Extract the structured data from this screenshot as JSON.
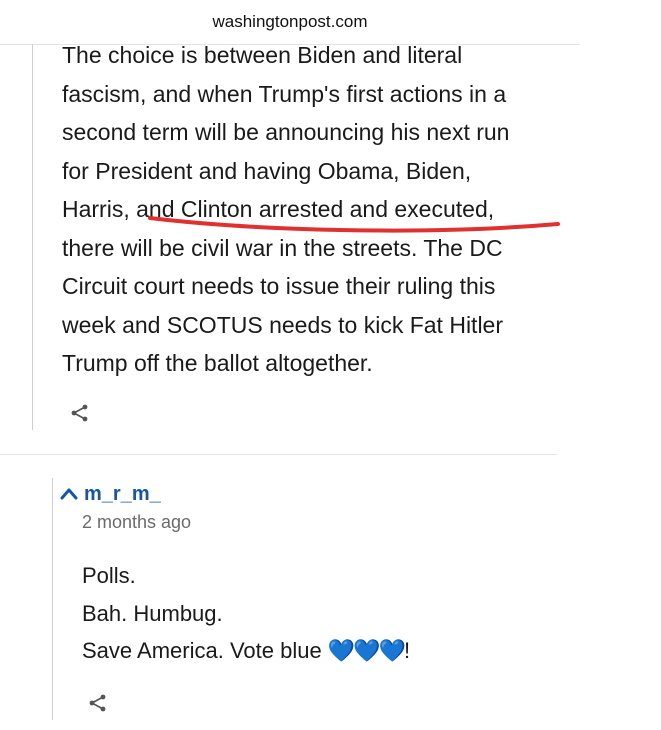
{
  "browser": {
    "url": "washingtonpost.com"
  },
  "comment_1": {
    "lines": [
      "The choice is between Biden and literal",
      "fascism, and when Trump's first actions in a",
      "second term will be announcing his next run",
      "for President and having Obama, Biden,",
      "Harris, and Clinton arrested and executed,",
      "there will be civil war in the streets. The DC",
      "Circuit court needs to issue their ruling this",
      "week and SCOTUS needs to kick Fat Hitler",
      "Trump off the ballot altogether."
    ],
    "share_icon": "share-icon"
  },
  "comment_2": {
    "author": "m_r_m_",
    "timestamp": "2 months ago",
    "lines": [
      "Polls.",
      "Bah. Humbug.",
      "Save America. Vote blue "
    ],
    "hearts": "💙💙💙",
    "trailing": "!",
    "share_icon": "share-icon"
  },
  "annotation": {
    "color": "#e0302f"
  },
  "colors": {
    "author": "#1955a5",
    "text": "#1a1a1a",
    "muted": "#6b6b6b"
  }
}
